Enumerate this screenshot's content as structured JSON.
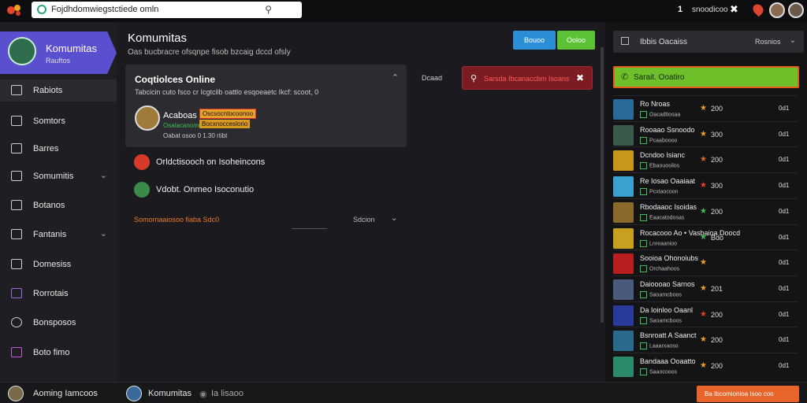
{
  "topbar": {
    "search_placeholder": "Fojdhdomwiegstctiede omln",
    "notification_count": "1",
    "user_label": "snoodicoo"
  },
  "sidebar": {
    "title": "Komumitas",
    "subtitle": "Rauftos",
    "items": [
      {
        "label": "Rabiots",
        "icon": "home-icon",
        "chevron": false
      },
      {
        "label": "Somtors",
        "icon": "gamepad-icon",
        "chevron": false
      },
      {
        "label": "Barres",
        "icon": "image-icon",
        "chevron": false
      },
      {
        "label": "Somumitis",
        "icon": "bell-icon",
        "chevron": true
      },
      {
        "label": "Botanos",
        "icon": "edit-icon",
        "chevron": false
      },
      {
        "label": "Fantanis",
        "icon": "users-icon",
        "chevron": true
      },
      {
        "label": "Domesiss",
        "icon": "chat-icon",
        "chevron": false
      },
      {
        "label": "Rorrotais",
        "icon": "tv-icon",
        "chevron": false
      },
      {
        "label": "Bonsposos",
        "icon": "pin-icon",
        "chevron": false
      },
      {
        "label": "Boto fimo",
        "icon": "flag-icon",
        "chevron": false
      }
    ]
  },
  "main": {
    "title": "Komumitas",
    "subtitle": "Oas bucbracre ofsqnpe fisob bzcaig dccd ofsly",
    "btn_blue": "Bouoo",
    "btn_green": "Ooloo",
    "card": {
      "title": "Coqtiolces Online",
      "description": "Tabcicin cuto fsco cr Icgtcilb oattlo esqoeaetc Ikcf: scoot, 0",
      "user_name": "Acaboas",
      "badge_top": "Oscsocntocoonoo",
      "badge_bottom": "Bocxnocceslorio",
      "role": "Osalacanomosme",
      "meta": "Oabat osoo 0 1.30 rtibt"
    },
    "rows": [
      {
        "text": "Orldctisooch on Isoheincons"
      },
      {
        "text": "Vdobt. Onmeo Isoconutio"
      }
    ],
    "stats_left": "Somornaaiosoo fiaba Sdc0",
    "stats_right": "Sdcion",
    "label_right": "Dcaad",
    "alert_text": "Sarsda Ibcanaccbm Isoans"
  },
  "right_panel": {
    "header_left": "Ibbis Oacaiss",
    "header_right": "Rosnios",
    "green_button": "Sarait. Ooatiro",
    "games": [
      {
        "name": "Ro Nroas",
        "tag": "Oacadtiosaa",
        "score": "200",
        "end": "0d1",
        "star_color": "#f0a020"
      },
      {
        "name": "Rooaao Ssnoodo",
        "tag": "Pcaaboooo",
        "score": "300",
        "end": "0d1",
        "star_color": "#f0a020"
      },
      {
        "name": "Dcndoo Isianc",
        "tag": "Ebaouosilos",
        "score": "200",
        "end": "0d1",
        "star_color": "#e86020"
      },
      {
        "name": "Re Iosao Oaaiaat",
        "tag": "Pcxtaocoon",
        "score": "300",
        "end": "0d1",
        "star_color": "#e84020"
      },
      {
        "name": "Rbodaaoc Isoidas",
        "tag": "Eaacatodosas",
        "score": "200",
        "end": "0d1",
        "star_color": "#3fbf5a"
      },
      {
        "name": "Rocacooo Ao • Vasbaioa Doocd",
        "tag": "Lnreaanioo",
        "score": "Bdo",
        "end": "0d1",
        "star_color": "#3fbf5a"
      },
      {
        "name": "Sooioa Ohonoiubs",
        "tag": "Orchaahoos",
        "score": "",
        "end": "0d1",
        "star_color": "#f0a020"
      },
      {
        "name": "Daioooao Sarnos",
        "tag": "Saoamcboos",
        "score": "201",
        "end": "0d1",
        "star_color": "#f0a020"
      },
      {
        "name": "Da Ioinloo Oaanl",
        "tag": "Saoamcboos",
        "score": "200",
        "end": "0d1",
        "star_color": "#e84020"
      },
      {
        "name": "Bsnroatt A Saanct",
        "tag": "Laaarxaoso",
        "score": "200",
        "end": "0d1",
        "star_color": "#f0a020"
      },
      {
        "name": "Bandaaa Ooaatto",
        "tag": "Saaocooos",
        "score": "200",
        "end": "0d1",
        "star_color": "#f0a020"
      }
    ]
  },
  "bottombar": {
    "left_text": "Aoming Iamcoos",
    "middle_text": "Komumitas",
    "tertiary_text": "Ia lisaoo",
    "orange_button": "Ba Ibcomionioa Isoo coo"
  },
  "colors": {
    "accent": "#5a4fcf",
    "alert": "#7a1c22",
    "green": "#6fbf2a",
    "orange": "#e8642a"
  }
}
